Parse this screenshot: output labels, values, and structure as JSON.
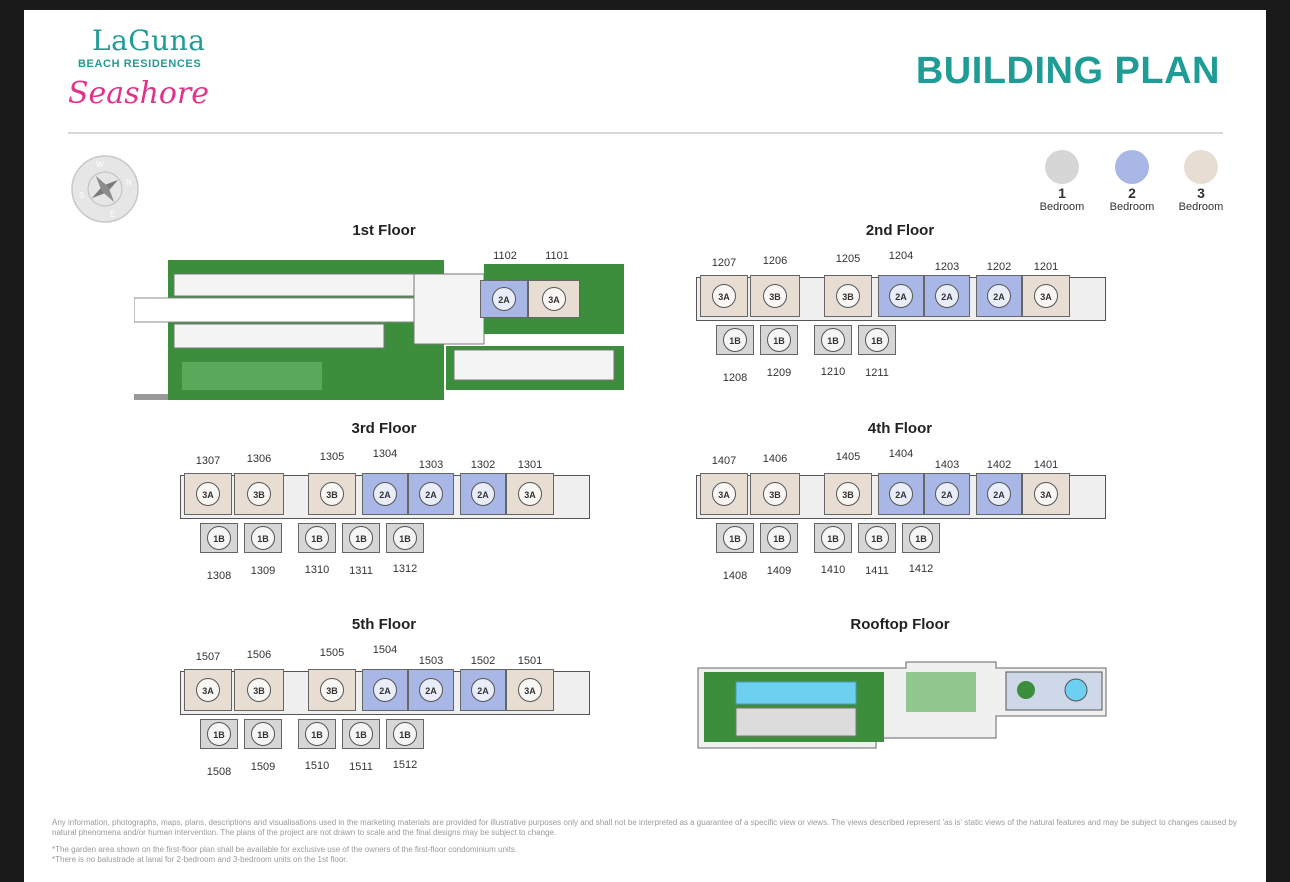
{
  "brand": {
    "line1": "LaGuna",
    "line2": "BEACH RESIDENCES",
    "line3": "Seashore"
  },
  "page_title": "BUILDING PLAN",
  "colors": {
    "teal": "#1f9c95",
    "pink": "#e0338a",
    "one_bed": "#d6d6d6",
    "two_bed": "#a9b7e6",
    "three_bed": "#e8ddd3",
    "green": "#3c8d3c"
  },
  "compass": {
    "n": "N",
    "e": "E",
    "s": "S",
    "w": "W"
  },
  "legend": [
    {
      "num": "1",
      "label": "Bedroom"
    },
    {
      "num": "2",
      "label": "Bedroom"
    },
    {
      "num": "3",
      "label": "Bedroom"
    }
  ],
  "floor_titles": [
    "1st Floor",
    "2nd Floor",
    "3rd Floor",
    "4th Floor",
    "5th Floor",
    "Rooftop Floor"
  ],
  "first_floor": {
    "units": [
      {
        "num": "1102",
        "type": "2A"
      },
      {
        "num": "1101",
        "type": "3A"
      }
    ]
  },
  "floors": [
    {
      "top": [
        {
          "num": "1207",
          "type": "3A"
        },
        {
          "num": "1206",
          "type": "3B"
        },
        {
          "num": "1205",
          "type": "3B"
        },
        {
          "num": "1204",
          "type": "2A"
        },
        {
          "num": "1203",
          "type": "2A"
        },
        {
          "num": "1202",
          "type": "2A"
        },
        {
          "num": "1201",
          "type": "3A"
        }
      ],
      "bottom": [
        {
          "num": "1208",
          "type": "1B"
        },
        {
          "num": "1209",
          "type": "1B"
        },
        {
          "num": "1210",
          "type": "1B"
        },
        {
          "num": "1211",
          "type": "1B"
        }
      ]
    },
    {
      "top": [
        {
          "num": "1307",
          "type": "3A"
        },
        {
          "num": "1306",
          "type": "3B"
        },
        {
          "num": "1305",
          "type": "3B"
        },
        {
          "num": "1304",
          "type": "2A"
        },
        {
          "num": "1303",
          "type": "2A"
        },
        {
          "num": "1302",
          "type": "2A"
        },
        {
          "num": "1301",
          "type": "3A"
        }
      ],
      "bottom": [
        {
          "num": "1308",
          "type": "1B"
        },
        {
          "num": "1309",
          "type": "1B"
        },
        {
          "num": "1310",
          "type": "1B"
        },
        {
          "num": "1311",
          "type": "1B"
        },
        {
          "num": "1312",
          "type": "1B"
        }
      ]
    },
    {
      "top": [
        {
          "num": "1407",
          "type": "3A"
        },
        {
          "num": "1406",
          "type": "3B"
        },
        {
          "num": "1405",
          "type": "3B"
        },
        {
          "num": "1404",
          "type": "2A"
        },
        {
          "num": "1403",
          "type": "2A"
        },
        {
          "num": "1402",
          "type": "2A"
        },
        {
          "num": "1401",
          "type": "3A"
        }
      ],
      "bottom": [
        {
          "num": "1408",
          "type": "1B"
        },
        {
          "num": "1409",
          "type": "1B"
        },
        {
          "num": "1410",
          "type": "1B"
        },
        {
          "num": "1411",
          "type": "1B"
        },
        {
          "num": "1412",
          "type": "1B"
        }
      ]
    },
    {
      "top": [
        {
          "num": "1507",
          "type": "3A"
        },
        {
          "num": "1506",
          "type": "3B"
        },
        {
          "num": "1505",
          "type": "3B"
        },
        {
          "num": "1504",
          "type": "2A"
        },
        {
          "num": "1503",
          "type": "2A"
        },
        {
          "num": "1502",
          "type": "2A"
        },
        {
          "num": "1501",
          "type": "3A"
        }
      ],
      "bottom": [
        {
          "num": "1508",
          "type": "1B"
        },
        {
          "num": "1509",
          "type": "1B"
        },
        {
          "num": "1510",
          "type": "1B"
        },
        {
          "num": "1511",
          "type": "1B"
        },
        {
          "num": "1512",
          "type": "1B"
        }
      ]
    }
  ],
  "disclaimer": {
    "main": "Any information, photographs, maps, plans, descriptions and visualisations used in the marketing materials are provided for illustrative purposes only and shall not be interpreted as a guarantee of a specific view or views. The views described represent 'as is' static views of the natural features and may be subject to changes caused by natural phenomena and/or human intervention. The plans of the project are not drawn to scale and the final designs may be subject to change.",
    "note1": "*The garden area shown on the first-floor plan shall be available for exclusive use of the owners of the first-floor condominium units.",
    "note2": "*There is no balustrade at lanai for 2-bedroom and 3-bedroom units on the 1st floor."
  }
}
